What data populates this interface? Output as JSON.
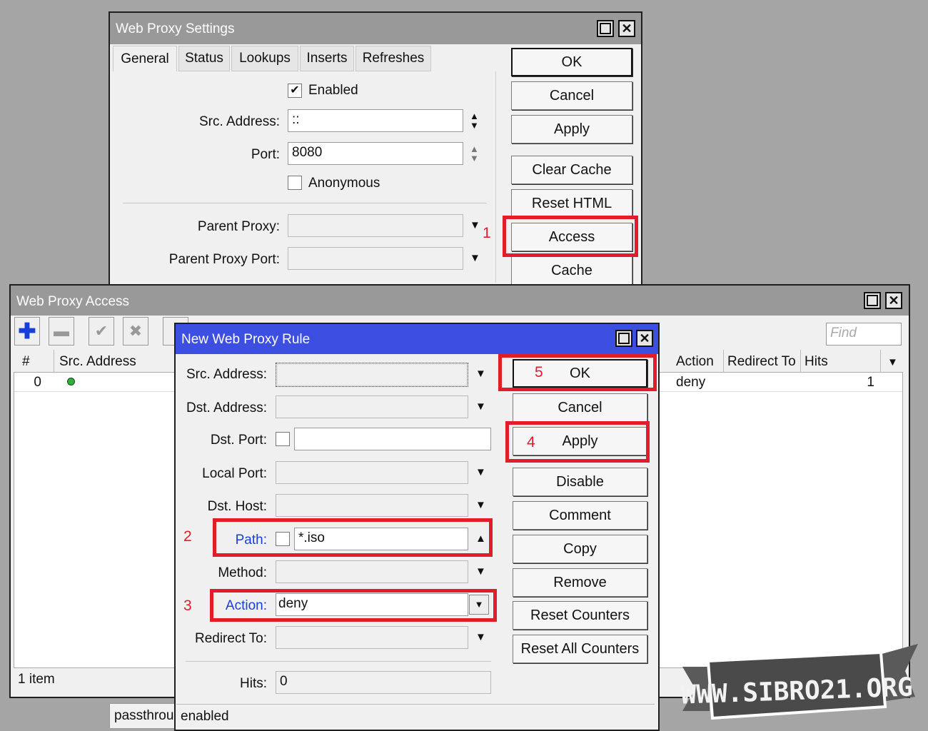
{
  "settings": {
    "title": "Web Proxy Settings",
    "tabs": [
      "General",
      "Status",
      "Lookups",
      "Inserts",
      "Refreshes"
    ],
    "enabled_label": "Enabled",
    "enabled_checked": true,
    "src_address_label": "Src. Address:",
    "src_address_value": "::",
    "port_label": "Port:",
    "port_value": "8080",
    "anonymous_label": "Anonymous",
    "anonymous_checked": false,
    "parent_proxy_label": "Parent Proxy:",
    "parent_proxy_port_label": "Parent Proxy Port:",
    "buttons": {
      "ok": "OK",
      "cancel": "Cancel",
      "apply": "Apply",
      "clear_cache": "Clear Cache",
      "reset_html": "Reset HTML",
      "access": "Access",
      "cache": "Cache"
    }
  },
  "access": {
    "title": "Web Proxy Access",
    "find_placeholder": "Find",
    "columns": {
      "num": "#",
      "src": "Src. Address",
      "action": "Action",
      "redirect": "Redirect To",
      "hits": "Hits"
    },
    "row": {
      "num": "0",
      "action": "deny",
      "hits": "1"
    },
    "status_items": "1 item",
    "status_passthrough": "passthrou"
  },
  "rule": {
    "title": "New Web Proxy Rule",
    "src_address_label": "Src. Address:",
    "dst_address_label": "Dst. Address:",
    "dst_port_label": "Dst. Port:",
    "local_port_label": "Local Port:",
    "dst_host_label": "Dst. Host:",
    "path_label": "Path:",
    "path_value": "*.iso",
    "method_label": "Method:",
    "action_label": "Action:",
    "action_value": "deny",
    "redirect_label": "Redirect To:",
    "hits_label": "Hits:",
    "hits_value": "0",
    "status": "enabled",
    "buttons": {
      "ok": "OK",
      "cancel": "Cancel",
      "apply": "Apply",
      "disable": "Disable",
      "comment": "Comment",
      "copy": "Copy",
      "remove": "Remove",
      "reset_counters": "Reset Counters",
      "reset_all_counters": "Reset All Counters"
    }
  },
  "annotations": {
    "n1": "1",
    "n2": "2",
    "n3": "3",
    "n4": "4",
    "n5": "5",
    "color": "#e11d2a"
  },
  "watermark": "WWW.SIBRO21.ORG"
}
